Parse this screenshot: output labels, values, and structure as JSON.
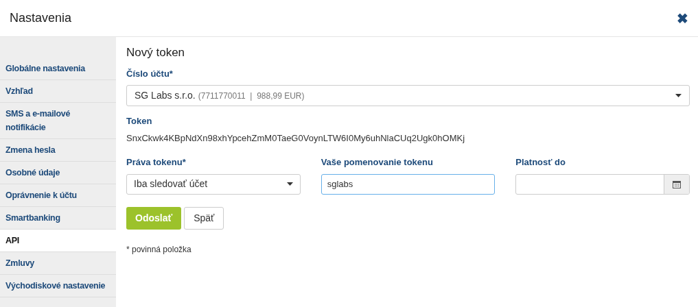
{
  "window": {
    "title": "Nastavenia",
    "close": "✖"
  },
  "sidebar": {
    "items": [
      {
        "label": "Globálne nastavenia",
        "selected": false
      },
      {
        "label": "Vzhľad",
        "selected": false
      },
      {
        "label": "SMS a e-mailové notifikácie",
        "selected": false
      },
      {
        "label": "Zmena hesla",
        "selected": false
      },
      {
        "label": "Osobné údaje",
        "selected": false
      },
      {
        "label": "Oprávnenie k účtu",
        "selected": false
      },
      {
        "label": "Smartbanking",
        "selected": false
      },
      {
        "label": "API",
        "selected": true
      },
      {
        "label": "Zmluvy",
        "selected": false
      },
      {
        "label": "Východiskové nastavenie",
        "selected": false
      }
    ]
  },
  "form": {
    "title": "Nový token",
    "account": {
      "label": "Číslo účtu*",
      "name": "SG Labs s.r.o.",
      "detail": "(7711770011  |  988,99 EUR)"
    },
    "token": {
      "label": "Token",
      "value": "SnxCkwk4KBpNdXn98xhYpcehZmM0TaeG0VoynLTW6I0My6uhNlaCUq2Ugk0hOMKj"
    },
    "rights": {
      "label": "Práva tokenu*",
      "value": "Iba sledovať účet"
    },
    "name": {
      "label": "Vaše pomenovanie tokenu",
      "value": "sglabs",
      "focused": true
    },
    "validity": {
      "label": "Platnosť do"
    },
    "buttons": [
      {
        "label": "Odoslať",
        "kind": "primary"
      },
      {
        "label": "Späť",
        "kind": "secondary"
      }
    ],
    "note": "* povinná položka"
  }
}
